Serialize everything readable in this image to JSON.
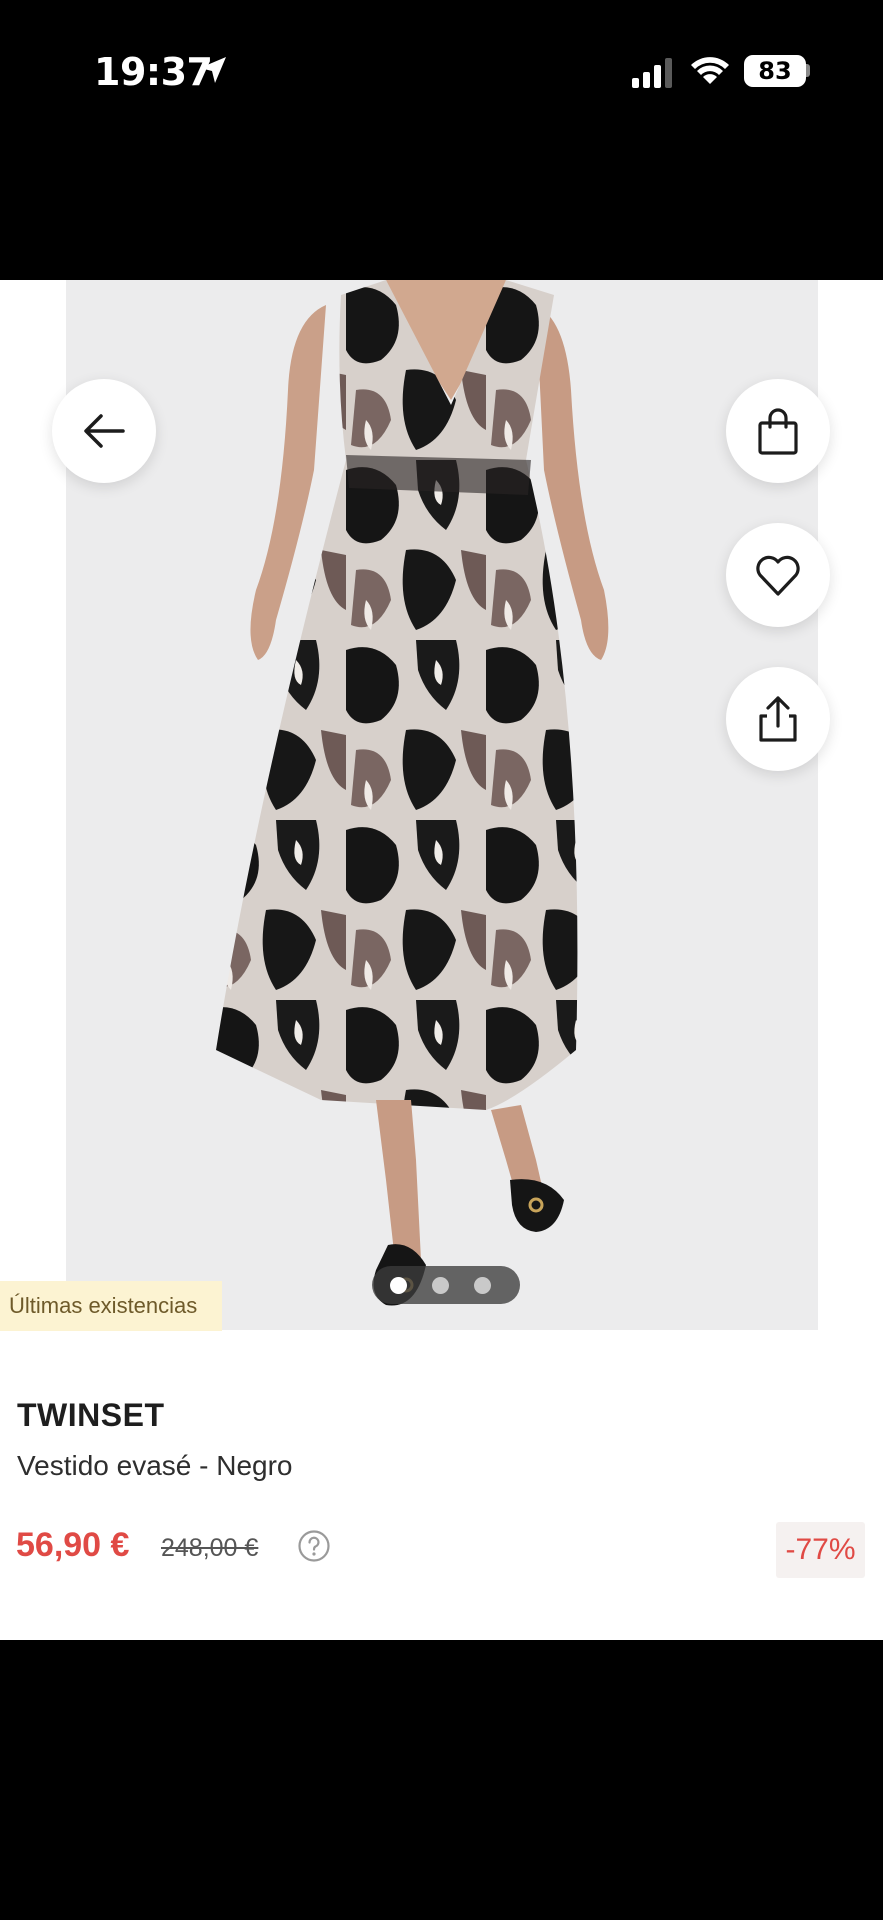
{
  "status_bar": {
    "time": "19:37",
    "battery": "83",
    "icons": [
      "location-arrow-icon",
      "signal-icon",
      "wifi-icon",
      "battery-icon"
    ]
  },
  "product": {
    "stock_badge": "Últimas existencias",
    "brand": "TWINSET",
    "name": "Vestido evasé - Negro",
    "price": "56,90 €",
    "old_price": "248,00 €",
    "discount": "-77%"
  },
  "carousel": {
    "total_images": 3,
    "active_index": 1
  },
  "actions": {
    "icons": [
      "back-arrow-icon",
      "shopping-bag-icon",
      "heart-icon",
      "share-icon",
      "help-icon"
    ]
  },
  "colors": {
    "price": "#e04a45",
    "badge_bg": "#fcf3d2",
    "hero_bg": "#ececed"
  }
}
